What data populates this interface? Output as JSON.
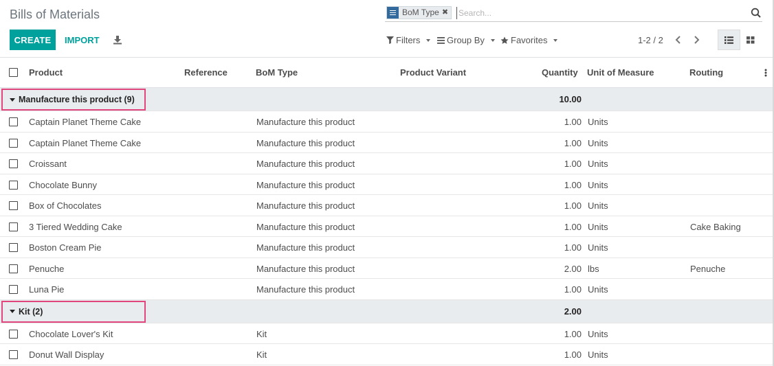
{
  "breadcrumb": "Bills of Materials",
  "buttons": {
    "create": "CREATE",
    "import": "IMPORT"
  },
  "search": {
    "facet": "BoM Type",
    "placeholder": "Search..."
  },
  "menus": {
    "filters": "Filters",
    "group_by": "Group By",
    "favorites": "Favorites"
  },
  "pager": "1-2 / 2",
  "columns": {
    "product": "Product",
    "reference": "Reference",
    "bom_type": "BoM Type",
    "product_variant": "Product Variant",
    "quantity": "Quantity",
    "uom": "Unit of Measure",
    "routing": "Routing"
  },
  "groups": [
    {
      "label": "Manufacture this product (9)",
      "total": "10.00",
      "rows": [
        {
          "product": "Captain Planet Theme Cake",
          "bom_type": "Manufacture this product",
          "quantity": "1.00",
          "uom": "Units",
          "routing": ""
        },
        {
          "product": "Captain Planet Theme Cake",
          "bom_type": "Manufacture this product",
          "quantity": "1.00",
          "uom": "Units",
          "routing": ""
        },
        {
          "product": "Croissant",
          "bom_type": "Manufacture this product",
          "quantity": "1.00",
          "uom": "Units",
          "routing": ""
        },
        {
          "product": "Chocolate Bunny",
          "bom_type": "Manufacture this product",
          "quantity": "1.00",
          "uom": "Units",
          "routing": ""
        },
        {
          "product": "Box of Chocolates",
          "bom_type": "Manufacture this product",
          "quantity": "1.00",
          "uom": "Units",
          "routing": ""
        },
        {
          "product": "3 Tiered Wedding Cake",
          "bom_type": "Manufacture this product",
          "quantity": "1.00",
          "uom": "Units",
          "routing": "Cake Baking"
        },
        {
          "product": "Boston Cream Pie",
          "bom_type": "Manufacture this product",
          "quantity": "1.00",
          "uom": "Units",
          "routing": ""
        },
        {
          "product": "Penuche",
          "bom_type": "Manufacture this product",
          "quantity": "2.00",
          "uom": "lbs",
          "routing": "Penuche"
        },
        {
          "product": "Luna Pie",
          "bom_type": "Manufacture this product",
          "quantity": "1.00",
          "uom": "Units",
          "routing": ""
        }
      ]
    },
    {
      "label": "Kit (2)",
      "total": "2.00",
      "rows": [
        {
          "product": "Chocolate Lover's Kit",
          "bom_type": "Kit",
          "quantity": "1.00",
          "uom": "Units",
          "routing": ""
        },
        {
          "product": "Donut Wall Display",
          "bom_type": "Kit",
          "quantity": "1.00",
          "uom": "Units",
          "routing": ""
        }
      ]
    }
  ],
  "colors": {
    "primary": "#00a09d",
    "facet": "#336a9e",
    "highlight": "#e0457b",
    "group_bg": "#e9ecef"
  }
}
